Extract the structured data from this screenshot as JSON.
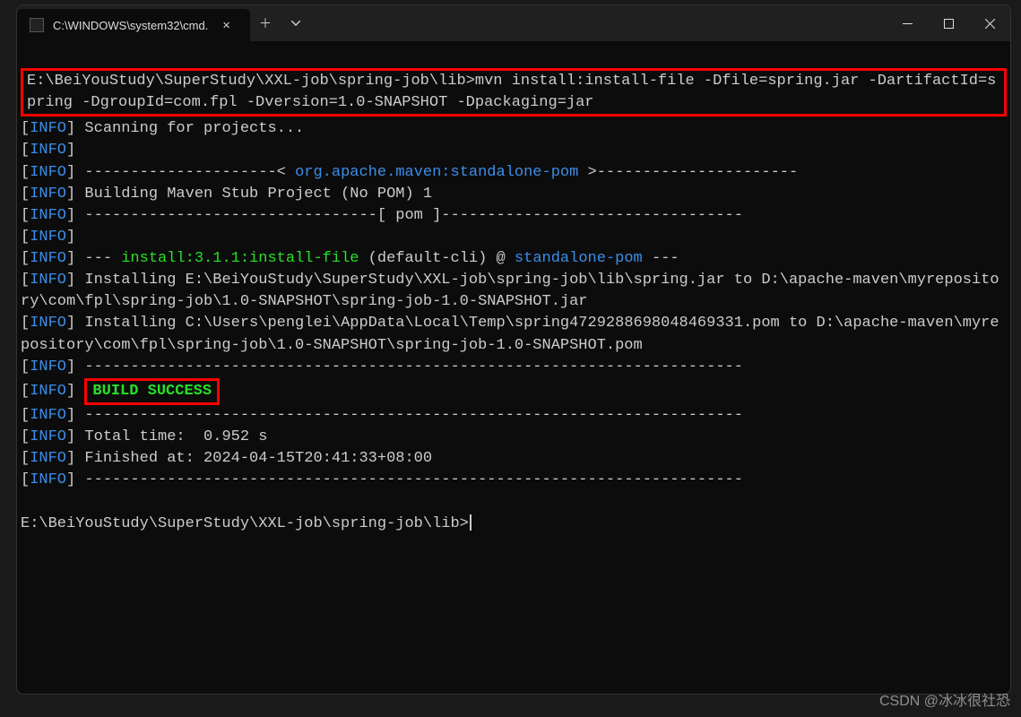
{
  "tab": {
    "title": "C:\\WINDOWS\\system32\\cmd."
  },
  "command": {
    "text": "E:\\BeiYouStudy\\SuperStudy\\XXL-job\\spring-job\\lib>mvn install:install-file -Dfile=spring.jar -DartifactId=spring -DgroupId=com.fpl -Dversion=1.0-SNAPSHOT -Dpackaging=jar"
  },
  "lines": {
    "scan": " Scanning for projects...",
    "dashOpen": " ---------------------< ",
    "coord": "org.apache.maven:standalone-pom",
    "dashClose": " >----------------------",
    "building": " Building Maven Stub Project (No POM) 1",
    "pomdash": " --------------------------------[ pom ]---------------------------------",
    "plugPre": " --- ",
    "plugin": "install:3.1.1:install-file",
    "plugMid": " (default-cli) @ ",
    "pomName": "standalone-pom",
    "plugPost": " ---",
    "installJar": " Installing E:\\BeiYouStudy\\SuperStudy\\XXL-job\\spring-job\\lib\\spring.jar to D:\\apache-maven\\myrepository\\com\\fpl\\spring-job\\1.0-SNAPSHOT\\spring-job-1.0-SNAPSHOT.jar",
    "installPom": " Installing C:\\Users\\penglei\\AppData\\Local\\Temp\\spring4729288698048469331.pom to D:\\apache-maven\\myrepository\\com\\fpl\\spring-job\\1.0-SNAPSHOT\\spring-job-1.0-SNAPSHOT.pom",
    "divider": " ------------------------------------------------------------------------",
    "success": "BUILD SUCCESS",
    "total": " Total time:  0.952 s",
    "finished": " Finished at: 2024-04-15T20:41:33+08:00"
  },
  "prompt2": "E:\\BeiYouStudy\\SuperStudy\\XXL-job\\spring-job\\lib>",
  "labels": {
    "info": "INFO"
  },
  "watermark": "CSDN @冰冰很社恐"
}
